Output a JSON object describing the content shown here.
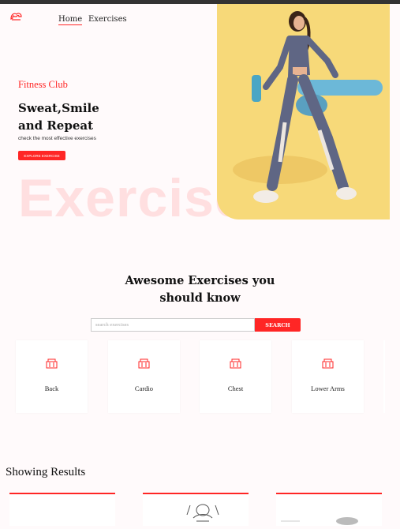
{
  "nav": {
    "home_label": "Home",
    "exercises_label": "Exercises"
  },
  "hero": {
    "tagline": "Fitness Club",
    "headline_line1": "Sweat,Smile",
    "headline_line2": "and Repeat",
    "subtitle": "check the most effective exercises",
    "cta_label": "EXPLORE EXERCISE",
    "background_word": "Exercise"
  },
  "search_section": {
    "title_line1": "Awesome Exercises you",
    "title_line2": "should know",
    "search_placeholder": "search exercises",
    "search_button": "SEARCH"
  },
  "body_parts": [
    {
      "label": "Back"
    },
    {
      "label": "Cardio"
    },
    {
      "label": "Chest"
    },
    {
      "label": "Lower Arms"
    }
  ],
  "results": {
    "title": "Showing Results"
  },
  "colors": {
    "accent": "#ff2625",
    "hero_bg": "#f7d979",
    "page_bg": "#fffafb"
  },
  "icons": [
    "gym-icon",
    "logo-icon"
  ]
}
